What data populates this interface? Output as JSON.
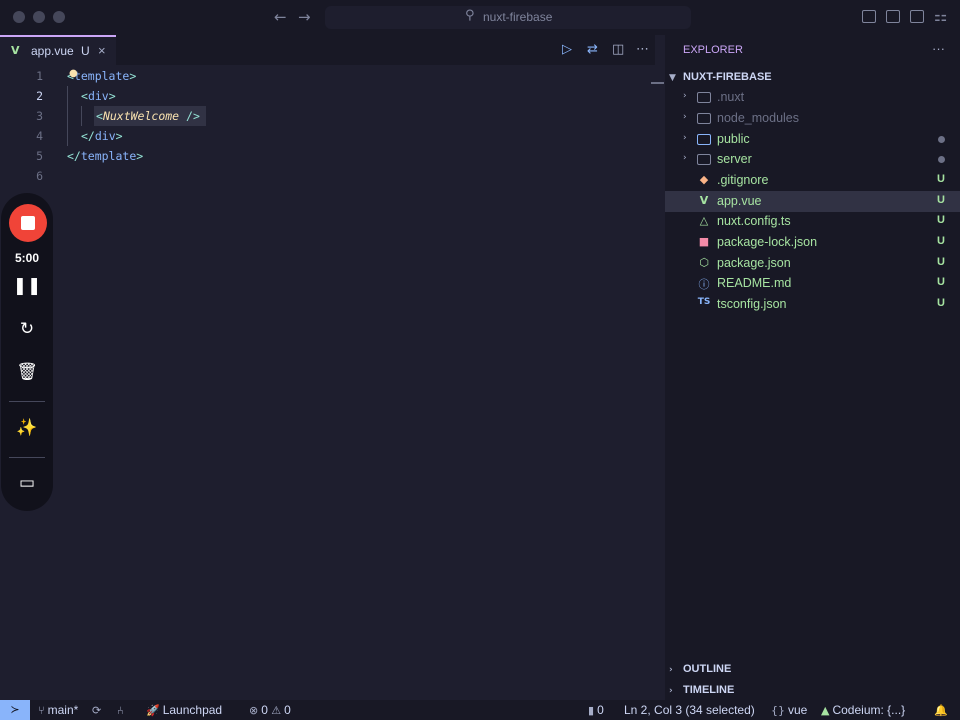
{
  "window": {
    "search_icon": "search-icon",
    "search_text": "nuxt-firebase"
  },
  "tab": {
    "name": "app.vue",
    "badge": "U",
    "close": "×"
  },
  "editor": {
    "lines": [
      {
        "num": "1"
      },
      {
        "num": "2"
      },
      {
        "num": "3"
      },
      {
        "num": "4"
      },
      {
        "num": "5"
      },
      {
        "num": "6"
      }
    ],
    "code": {
      "l1_open": "<",
      "l1_tag": "template",
      "l1_close": ">",
      "l2_open": "<",
      "l2_tag": "div",
      "l2_close": ">",
      "l3_open": "<",
      "l3_comp": "NuxtWelcome",
      "l3_close": " />",
      "l4_open": "</",
      "l4_tag": "div",
      "l4_close": ">",
      "l5_open": "</",
      "l5_tag": "template",
      "l5_close": ">"
    }
  },
  "recorder": {
    "time": "5:00",
    "accent": "#f04438"
  },
  "sidebar": {
    "title": "EXPLORER",
    "more": "···",
    "project": "NUXT-FIREBASE",
    "items": [
      {
        "name": ".nuxt",
        "status": ""
      },
      {
        "name": "node_modules",
        "status": ""
      },
      {
        "name": "public",
        "status": ""
      },
      {
        "name": "server",
        "status": ""
      },
      {
        "name": ".gitignore",
        "status": "U"
      },
      {
        "name": "app.vue",
        "status": "U"
      },
      {
        "name": "nuxt.config.ts",
        "status": "U"
      },
      {
        "name": "package-lock.json",
        "status": "U"
      },
      {
        "name": "package.json",
        "status": "U"
      },
      {
        "name": "README.md",
        "status": "U"
      },
      {
        "name": "tsconfig.json",
        "status": "U"
      }
    ],
    "outline": "OUTLINE",
    "timeline": "TIMELINE"
  },
  "statusbar": {
    "branch": "main*",
    "launchpad": "Launchpad",
    "errors": "0",
    "warnings": "0",
    "ports": "0",
    "cursor": "Ln 2, Col 3 (34 selected)",
    "language": "vue",
    "codeium": "Codeium: {...}"
  },
  "colors": {
    "accent": "#cba6f7",
    "modified": "#a6e3a1",
    "background": "#1e1e2e"
  }
}
